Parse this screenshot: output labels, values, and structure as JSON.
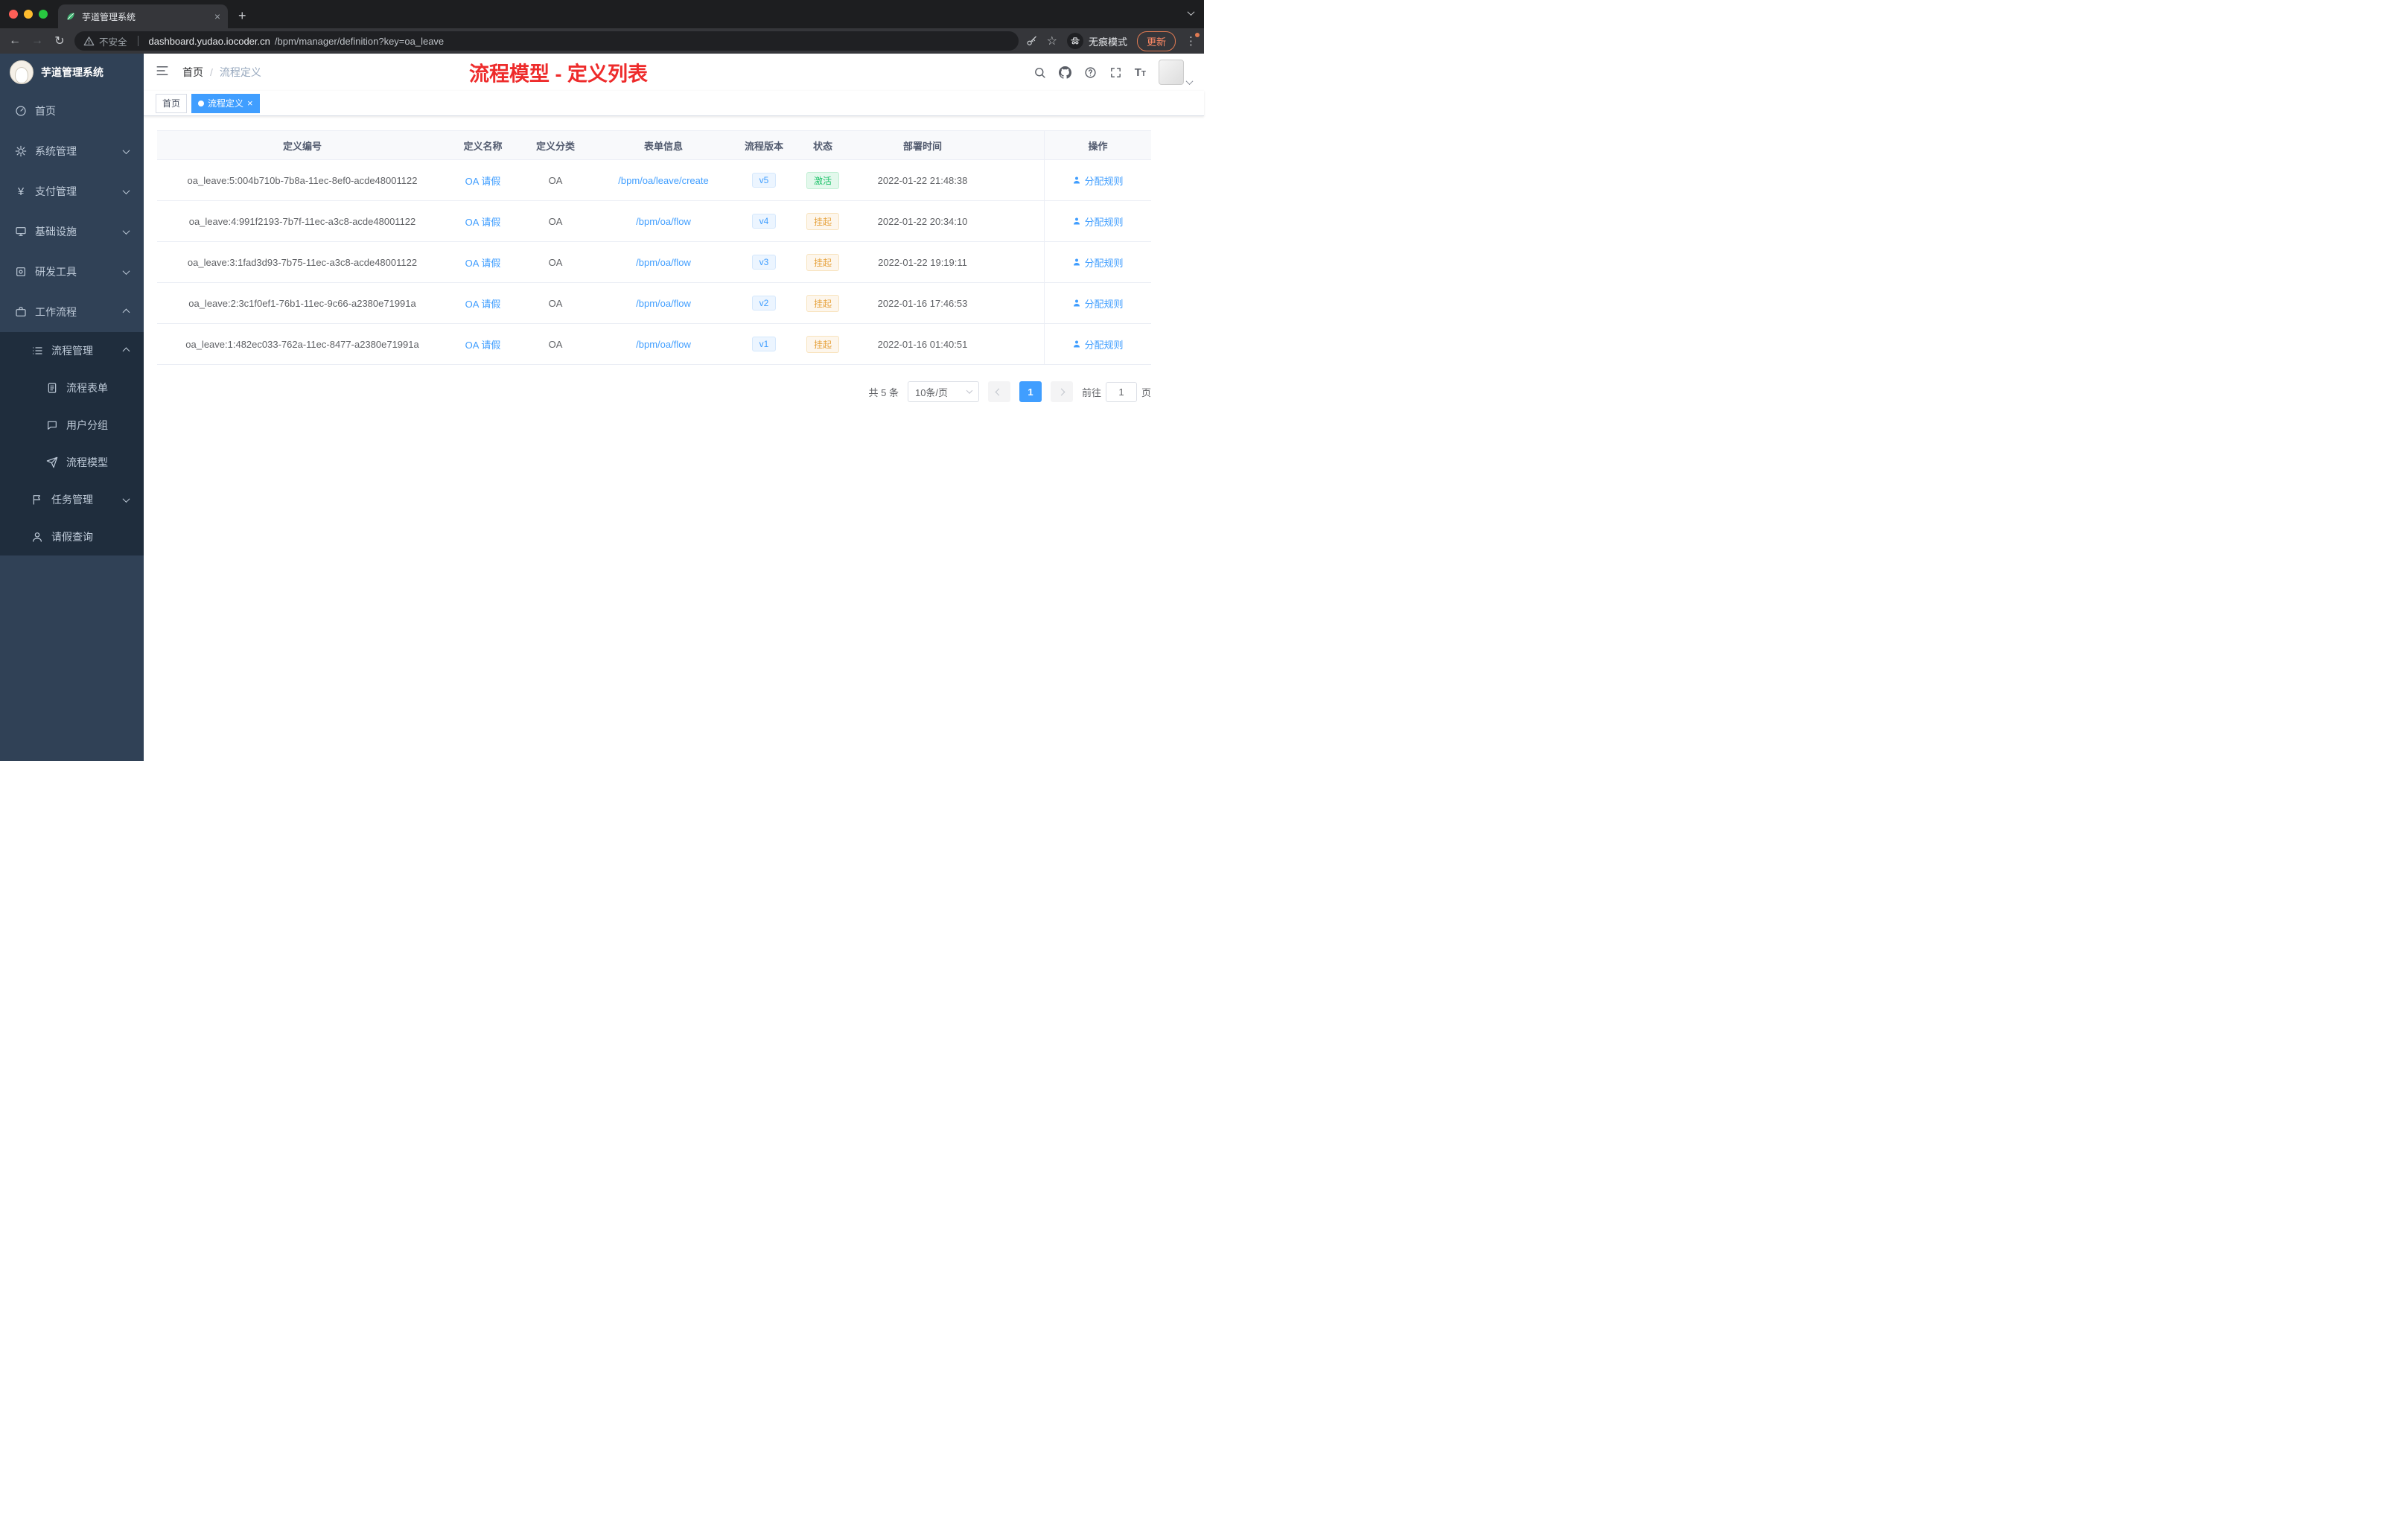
{
  "browser": {
    "tab_title": "芋道管理系统",
    "security_label": "不安全",
    "url_host": "dashboard.yudao.iocoder.cn",
    "url_path": "/bpm/manager/definition?key=oa_leave",
    "incognito_label": "无痕模式",
    "update_label": "更新"
  },
  "icons": {
    "close": "×",
    "plus": "+",
    "back": "←",
    "forward": "→",
    "refresh": "↻",
    "star": "☆",
    "kebab": "⋮",
    "yen": "¥",
    "breadcrumb_separator": "/",
    "fontsize_large": "T",
    "fontsize_small": "T"
  },
  "sidebar": {
    "brand": "芋道管理系统",
    "items": [
      {
        "label": "首页"
      },
      {
        "label": "系统管理"
      },
      {
        "label": "支付管理"
      },
      {
        "label": "基础设施"
      },
      {
        "label": "研发工具"
      },
      {
        "label": "工作流程"
      },
      {
        "label": "流程管理"
      },
      {
        "label": "流程表单"
      },
      {
        "label": "用户分组"
      },
      {
        "label": "流程模型"
      },
      {
        "label": "任务管理"
      },
      {
        "label": "请假查询"
      }
    ]
  },
  "navbar": {
    "breadcrumb_home": "首页",
    "breadcrumb_current": "流程定义",
    "annotation": "流程模型 - 定义列表"
  },
  "tags": {
    "home": "首页",
    "current": "流程定义"
  },
  "table": {
    "columns": [
      "定义编号",
      "定义名称",
      "定义分类",
      "表单信息",
      "流程版本",
      "状态",
      "部署时间",
      "操作"
    ],
    "rows": [
      {
        "id": "oa_leave:5:004b710b-7b8a-11ec-8ef0-acde48001122",
        "name": "OA 请假",
        "category": "OA",
        "form": "/bpm/oa/leave/create",
        "version": "v5",
        "status": "激活",
        "deploy_time": "2022-01-22 21:48:38",
        "action": "分配规则"
      },
      {
        "id": "oa_leave:4:991f2193-7b7f-11ec-a3c8-acde48001122",
        "name": "OA 请假",
        "category": "OA",
        "form": "/bpm/oa/flow",
        "version": "v4",
        "status": "挂起",
        "deploy_time": "2022-01-22 20:34:10",
        "action": "分配规则"
      },
      {
        "id": "oa_leave:3:1fad3d93-7b75-11ec-a3c8-acde48001122",
        "name": "OA 请假",
        "category": "OA",
        "form": "/bpm/oa/flow",
        "version": "v3",
        "status": "挂起",
        "deploy_time": "2022-01-22 19:19:11",
        "action": "分配规则"
      },
      {
        "id": "oa_leave:2:3c1f0ef1-76b1-11ec-9c66-a2380e71991a",
        "name": "OA 请假",
        "category": "OA",
        "form": "/bpm/oa/flow",
        "version": "v2",
        "status": "挂起",
        "deploy_time": "2022-01-16 17:46:53",
        "action": "分配规则"
      },
      {
        "id": "oa_leave:1:482ec033-762a-11ec-8477-a2380e71991a",
        "name": "OA 请假",
        "category": "OA",
        "form": "/bpm/oa/flow",
        "version": "v1",
        "status": "挂起",
        "deploy_time": "2022-01-16 01:40:51",
        "action": "分配规则"
      }
    ]
  },
  "pagination": {
    "total": "共 5 条",
    "page_size": "10条/页",
    "current_page": "1",
    "goto_label": "前往",
    "goto_value": "1",
    "goto_unit": "页"
  },
  "colors": {
    "accent": "#409eff",
    "success": "#1ec26a",
    "warning": "#e6a23c",
    "sidebar": "#304156",
    "annotation": "#ee2b2b"
  }
}
